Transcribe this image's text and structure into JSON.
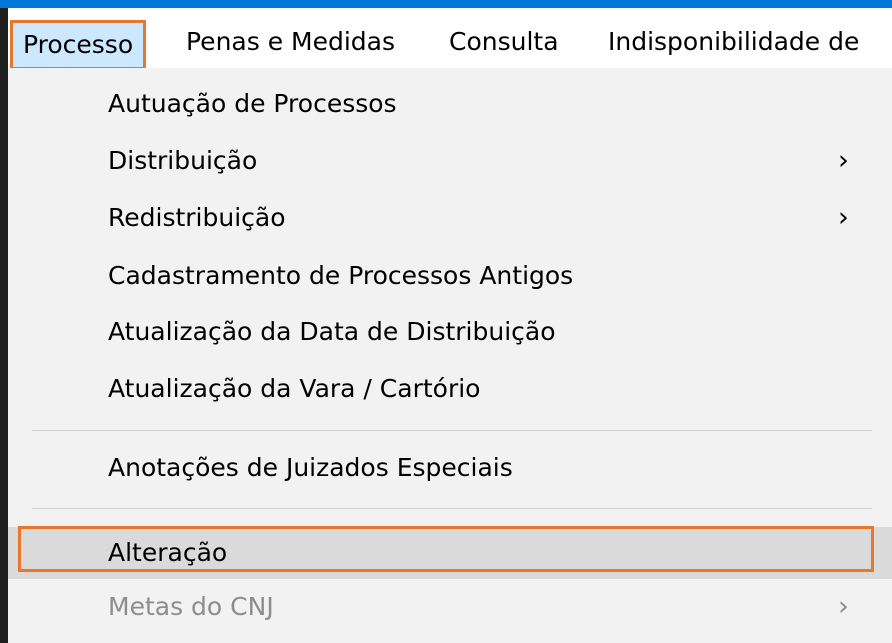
{
  "menubar": {
    "items": [
      {
        "label": "Processo"
      },
      {
        "label": "Penas e Medidas"
      },
      {
        "label": "Consulta"
      },
      {
        "label": "Indisponibilidade de"
      }
    ]
  },
  "dropdown": {
    "items": [
      {
        "label": "Autuação de Processos",
        "submenu": false,
        "enabled": true
      },
      {
        "label": "Distribuição",
        "submenu": true,
        "enabled": true
      },
      {
        "label": "Redistribuição",
        "submenu": true,
        "enabled": true
      },
      {
        "label": "Cadastramento de Processos Antigos",
        "submenu": false,
        "enabled": true
      },
      {
        "label": "Atualização da Data de Distribuição",
        "submenu": false,
        "enabled": true
      },
      {
        "label": "Atualização da Vara / Cartório",
        "submenu": false,
        "enabled": true
      },
      {
        "label": "Anotações de Juizados Especiais",
        "submenu": false,
        "enabled": true
      },
      {
        "label": "Alteração",
        "submenu": false,
        "enabled": true,
        "highlighted": true
      },
      {
        "label": "Metas do CNJ",
        "submenu": true,
        "enabled": false
      }
    ],
    "submenu_glyph": "›"
  },
  "colors": {
    "highlight_outline": "#e8772e",
    "title_strip": "#0078d7",
    "menu_background": "#f2f2f2",
    "disabled_text": "#8d8d8d"
  }
}
